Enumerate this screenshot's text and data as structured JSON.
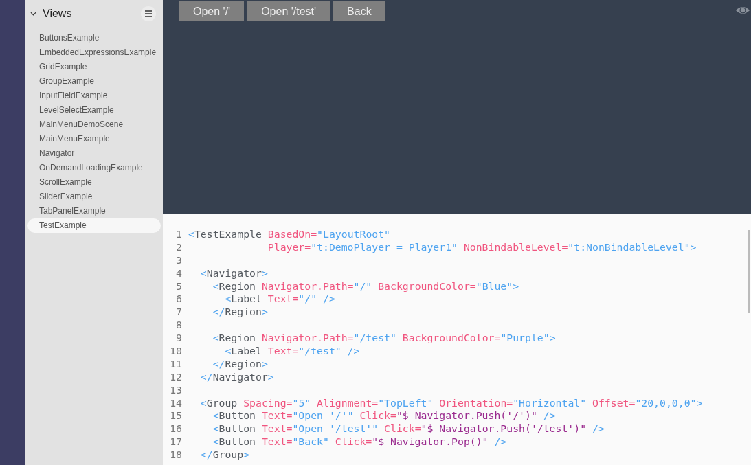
{
  "sidebar": {
    "title": "Views",
    "expanded": true,
    "items": [
      {
        "label": "ButtonsExample",
        "selected": false
      },
      {
        "label": "EmbeddedExpressionsExample",
        "selected": false
      },
      {
        "label": "GridExample",
        "selected": false
      },
      {
        "label": "GroupExample",
        "selected": false
      },
      {
        "label": "InputFieldExample",
        "selected": false
      },
      {
        "label": "LevelSelectExample",
        "selected": false
      },
      {
        "label": "MainMenuDemoScene",
        "selected": false
      },
      {
        "label": "MainMenuExample",
        "selected": false
      },
      {
        "label": "Navigator",
        "selected": false
      },
      {
        "label": "OnDemandLoadingExample",
        "selected": false
      },
      {
        "label": "ScrollExample",
        "selected": false
      },
      {
        "label": "SliderExample",
        "selected": false
      },
      {
        "label": "TabPanelExample",
        "selected": false
      },
      {
        "label": "TestExample",
        "selected": true
      }
    ]
  },
  "preview": {
    "buttons": [
      "Open '/'",
      "Open '/test'",
      "Back"
    ]
  },
  "code": {
    "lines": [
      {
        "number": "1",
        "tokens": [
          {
            "kind": "punct",
            "text": "<"
          },
          {
            "kind": "name",
            "text": "TestExample "
          },
          {
            "kind": "attr",
            "text": "BasedOn="
          },
          {
            "kind": "value",
            "text": "\"LayoutRoot\""
          }
        ]
      },
      {
        "number": "2",
        "tokens": [
          {
            "kind": "attr",
            "text": "             Player="
          },
          {
            "kind": "value",
            "text": "\"t:DemoPlayer = Player1\" "
          },
          {
            "kind": "attr",
            "text": "NonBindableLevel="
          },
          {
            "kind": "value",
            "text": "\"t:NonBindableLevel\">"
          }
        ]
      },
      {
        "number": "3"
      },
      {
        "number": "4",
        "tokens": [
          {
            "kind": "punct",
            "text": "  <"
          },
          {
            "kind": "name",
            "text": "Navigator"
          },
          {
            "kind": "punct",
            "text": ">"
          }
        ]
      },
      {
        "number": "5",
        "tokens": [
          {
            "kind": "punct",
            "text": "    <"
          },
          {
            "kind": "name",
            "text": "Region "
          },
          {
            "kind": "attr",
            "text": "Navigator.Path="
          },
          {
            "kind": "value",
            "text": "\"/\" "
          },
          {
            "kind": "attr",
            "text": "BackgroundColor="
          },
          {
            "kind": "value",
            "text": "\"Blue\">"
          }
        ]
      },
      {
        "number": "6",
        "tokens": [
          {
            "kind": "punct",
            "text": "      <"
          },
          {
            "kind": "name",
            "text": "Label "
          },
          {
            "kind": "attr",
            "text": "Text="
          },
          {
            "kind": "value",
            "text": "\"/\" />"
          }
        ]
      },
      {
        "number": "7",
        "tokens": [
          {
            "kind": "punct",
            "text": "    </"
          },
          {
            "kind": "name",
            "text": "Region"
          },
          {
            "kind": "punct",
            "text": ">"
          }
        ]
      },
      {
        "number": "8"
      },
      {
        "number": "9",
        "tokens": [
          {
            "kind": "punct",
            "text": "    <"
          },
          {
            "kind": "name",
            "text": "Region "
          },
          {
            "kind": "attr",
            "text": "Navigator.Path="
          },
          {
            "kind": "value",
            "text": "\"/test\" "
          },
          {
            "kind": "attr",
            "text": "BackgroundColor="
          },
          {
            "kind": "value",
            "text": "\"Purple\">"
          }
        ]
      },
      {
        "number": "10",
        "tokens": [
          {
            "kind": "punct",
            "text": "      <"
          },
          {
            "kind": "name",
            "text": "Label "
          },
          {
            "kind": "attr",
            "text": "Text="
          },
          {
            "kind": "value",
            "text": "\"/test\" />"
          }
        ]
      },
      {
        "number": "11",
        "tokens": [
          {
            "kind": "punct",
            "text": "    </"
          },
          {
            "kind": "name",
            "text": "Region"
          },
          {
            "kind": "punct",
            "text": ">"
          }
        ]
      },
      {
        "number": "12",
        "tokens": [
          {
            "kind": "punct",
            "text": "  </"
          },
          {
            "kind": "name",
            "text": "Navigator"
          },
          {
            "kind": "punct",
            "text": ">"
          }
        ]
      },
      {
        "number": "13"
      },
      {
        "number": "14",
        "tokens": [
          {
            "kind": "punct",
            "text": "  <"
          },
          {
            "kind": "name",
            "text": "Group "
          },
          {
            "kind": "attr",
            "text": "Spacing="
          },
          {
            "kind": "value",
            "text": "\"5\" "
          },
          {
            "kind": "attr",
            "text": "Alignment="
          },
          {
            "kind": "value",
            "text": "\"TopLeft\" "
          },
          {
            "kind": "attr",
            "text": "Orientation="
          },
          {
            "kind": "value",
            "text": "\"Horizontal\" "
          },
          {
            "kind": "attr",
            "text": "Offset="
          },
          {
            "kind": "value",
            "text": "\"20,0,0,0\">"
          }
        ]
      },
      {
        "number": "15",
        "tokens": [
          {
            "kind": "punct",
            "text": "    <"
          },
          {
            "kind": "name",
            "text": "Button "
          },
          {
            "kind": "attr",
            "text": "Text="
          },
          {
            "kind": "value",
            "text": "\"Open '/'\" "
          },
          {
            "kind": "attr",
            "text": "Click="
          },
          {
            "kind": "expr",
            "text": "\"$ Navigator.Push('/')\""
          },
          {
            "kind": "value",
            "text": " />"
          }
        ]
      },
      {
        "number": "16",
        "tokens": [
          {
            "kind": "punct",
            "text": "    <"
          },
          {
            "kind": "name",
            "text": "Button "
          },
          {
            "kind": "attr",
            "text": "Text="
          },
          {
            "kind": "value",
            "text": "\"Open '/test'\" "
          },
          {
            "kind": "attr",
            "text": "Click="
          },
          {
            "kind": "expr",
            "text": "\"$ Navigator.Push('/test')\""
          },
          {
            "kind": "value",
            "text": " />"
          }
        ]
      },
      {
        "number": "17",
        "tokens": [
          {
            "kind": "punct",
            "text": "    <"
          },
          {
            "kind": "name",
            "text": "Button "
          },
          {
            "kind": "attr",
            "text": "Text="
          },
          {
            "kind": "value",
            "text": "\"Back\" "
          },
          {
            "kind": "attr",
            "text": "Click="
          },
          {
            "kind": "expr",
            "text": "\"$ Navigator.Pop()\""
          },
          {
            "kind": "value",
            "text": " />"
          }
        ]
      },
      {
        "number": "18",
        "tokens": [
          {
            "kind": "punct",
            "text": "  </"
          },
          {
            "kind": "name",
            "text": "Group"
          },
          {
            "kind": "punct",
            "text": ">"
          }
        ]
      }
    ]
  }
}
